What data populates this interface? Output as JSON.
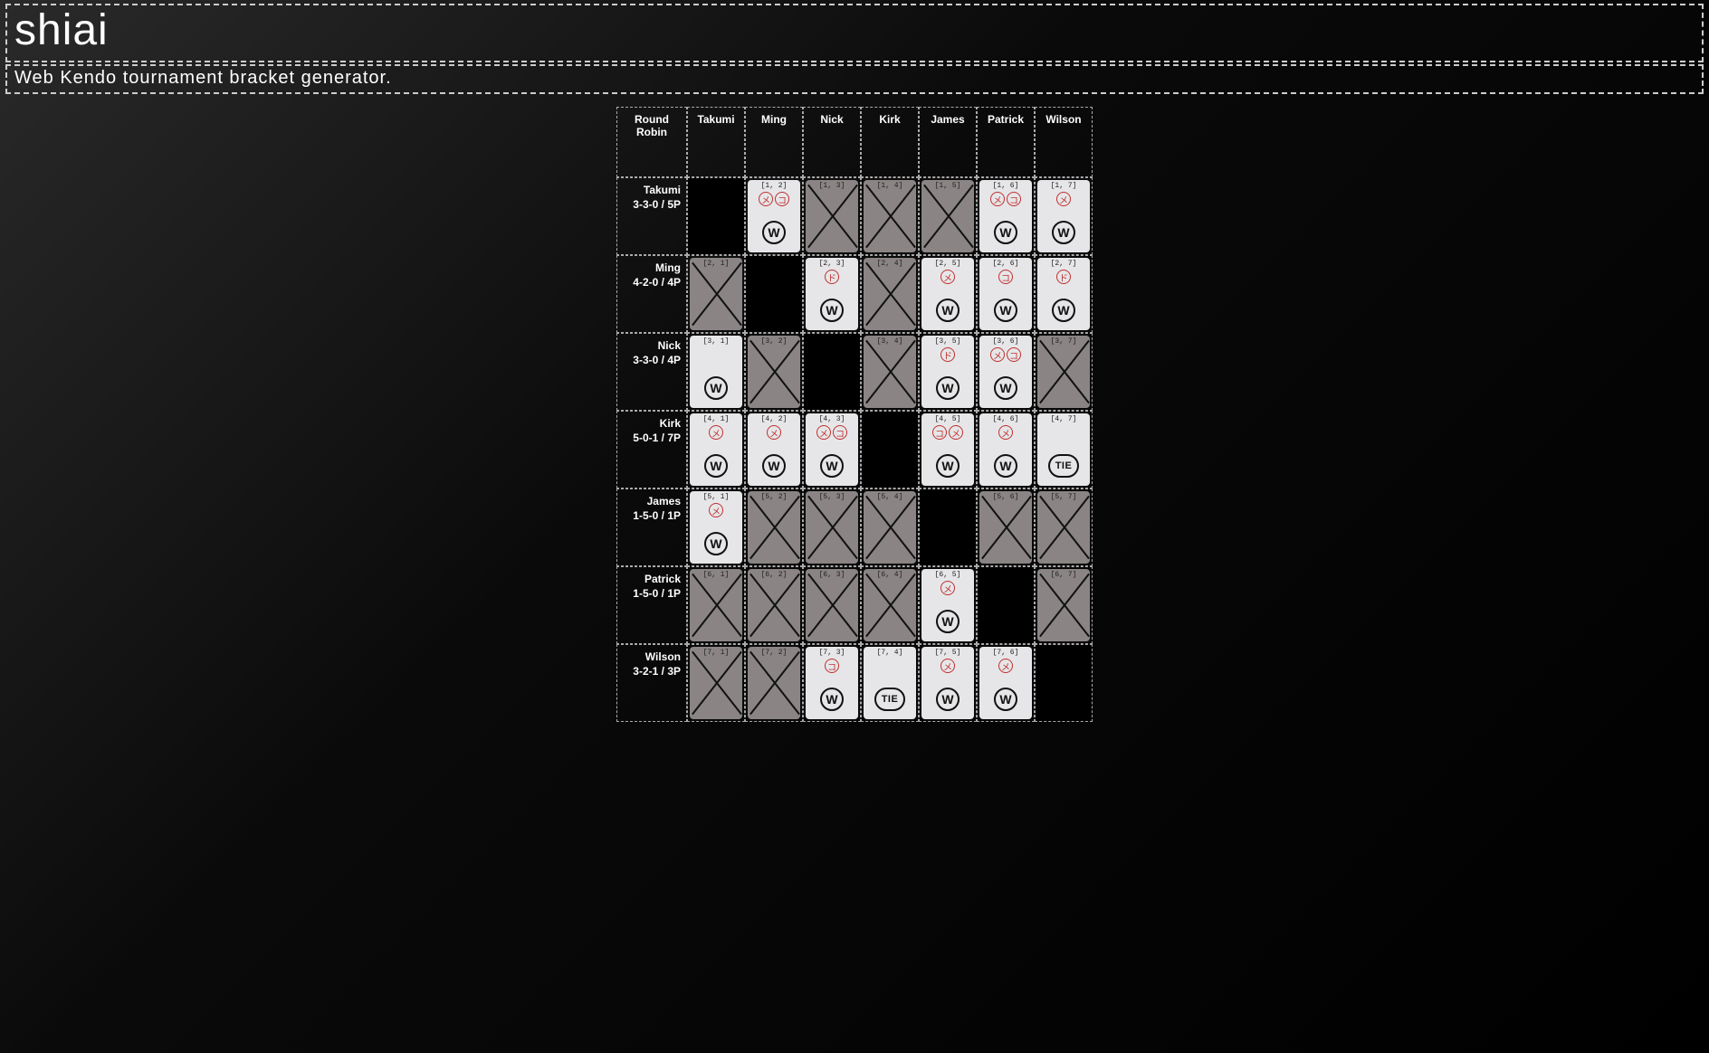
{
  "header": {
    "title": "shiai",
    "subtitle": "Web Kendo tournament bracket generator."
  },
  "corner_label": "Round Robin",
  "players": [
    {
      "name": "Takumi",
      "record": "3-3-0 / 5P"
    },
    {
      "name": "Ming",
      "record": "4-2-0 / 4P"
    },
    {
      "name": "Nick",
      "record": "3-3-0 / 4P"
    },
    {
      "name": "Kirk",
      "record": "5-0-1 / 7P"
    },
    {
      "name": "James",
      "record": "1-5-0 / 1P"
    },
    {
      "name": "Patrick",
      "record": "1-5-0 / 1P"
    },
    {
      "name": "Wilson",
      "record": "3-2-1 / 3P"
    }
  ],
  "cells": [
    [
      null,
      {
        "coord": "[1, 2]",
        "result": "W",
        "points": [
          "メ",
          "コ"
        ]
      },
      {
        "coord": "[1, 3]",
        "result": "L"
      },
      {
        "coord": "[1, 4]",
        "result": "L"
      },
      {
        "coord": "[1, 5]",
        "result": "L"
      },
      {
        "coord": "[1, 6]",
        "result": "W",
        "points": [
          "メ",
          "コ"
        ]
      },
      {
        "coord": "[1, 7]",
        "result": "W",
        "points": [
          "メ"
        ]
      }
    ],
    [
      {
        "coord": "[2, 1]",
        "result": "L"
      },
      null,
      {
        "coord": "[2, 3]",
        "result": "W",
        "points": [
          "ド"
        ]
      },
      {
        "coord": "[2, 4]",
        "result": "L"
      },
      {
        "coord": "[2, 5]",
        "result": "W",
        "points": [
          "メ"
        ]
      },
      {
        "coord": "[2, 6]",
        "result": "W",
        "points": [
          "コ"
        ]
      },
      {
        "coord": "[2, 7]",
        "result": "W",
        "points": [
          "ド"
        ]
      }
    ],
    [
      {
        "coord": "[3, 1]",
        "result": "W",
        "points": []
      },
      {
        "coord": "[3, 2]",
        "result": "L"
      },
      null,
      {
        "coord": "[3, 4]",
        "result": "L"
      },
      {
        "coord": "[3, 5]",
        "result": "W",
        "points": [
          "ド"
        ]
      },
      {
        "coord": "[3, 6]",
        "result": "W",
        "points": [
          "メ",
          "コ"
        ]
      },
      {
        "coord": "[3, 7]",
        "result": "L"
      }
    ],
    [
      {
        "coord": "[4, 1]",
        "result": "W",
        "points": [
          "メ"
        ]
      },
      {
        "coord": "[4, 2]",
        "result": "W",
        "points": [
          "メ"
        ]
      },
      {
        "coord": "[4, 3]",
        "result": "W",
        "points": [
          "メ",
          "コ"
        ]
      },
      null,
      {
        "coord": "[4, 5]",
        "result": "W",
        "points": [
          "コ",
          "メ"
        ]
      },
      {
        "coord": "[4, 6]",
        "result": "W",
        "points": [
          "メ"
        ]
      },
      {
        "coord": "[4, 7]",
        "result": "TIE",
        "points": []
      }
    ],
    [
      {
        "coord": "[5, 1]",
        "result": "W",
        "points": [
          "メ"
        ]
      },
      {
        "coord": "[5, 2]",
        "result": "L"
      },
      {
        "coord": "[5, 3]",
        "result": "L"
      },
      {
        "coord": "[5, 4]",
        "result": "L"
      },
      null,
      {
        "coord": "[5, 6]",
        "result": "L"
      },
      {
        "coord": "[5, 7]",
        "result": "L"
      }
    ],
    [
      {
        "coord": "[6, 1]",
        "result": "L"
      },
      {
        "coord": "[6, 2]",
        "result": "L"
      },
      {
        "coord": "[6, 3]",
        "result": "L"
      },
      {
        "coord": "[6, 4]",
        "result": "L"
      },
      {
        "coord": "[6, 5]",
        "result": "W",
        "points": [
          "メ"
        ]
      },
      null,
      {
        "coord": "[6, 7]",
        "result": "L"
      }
    ],
    [
      {
        "coord": "[7, 1]",
        "result": "L"
      },
      {
        "coord": "[7, 2]",
        "result": "L"
      },
      {
        "coord": "[7, 3]",
        "result": "W",
        "points": [
          "コ"
        ]
      },
      {
        "coord": "[7, 4]",
        "result": "TIE",
        "points": []
      },
      {
        "coord": "[7, 5]",
        "result": "W",
        "points": [
          "メ"
        ]
      },
      {
        "coord": "[7, 6]",
        "result": "W",
        "points": [
          "メ"
        ]
      },
      null
    ]
  ]
}
